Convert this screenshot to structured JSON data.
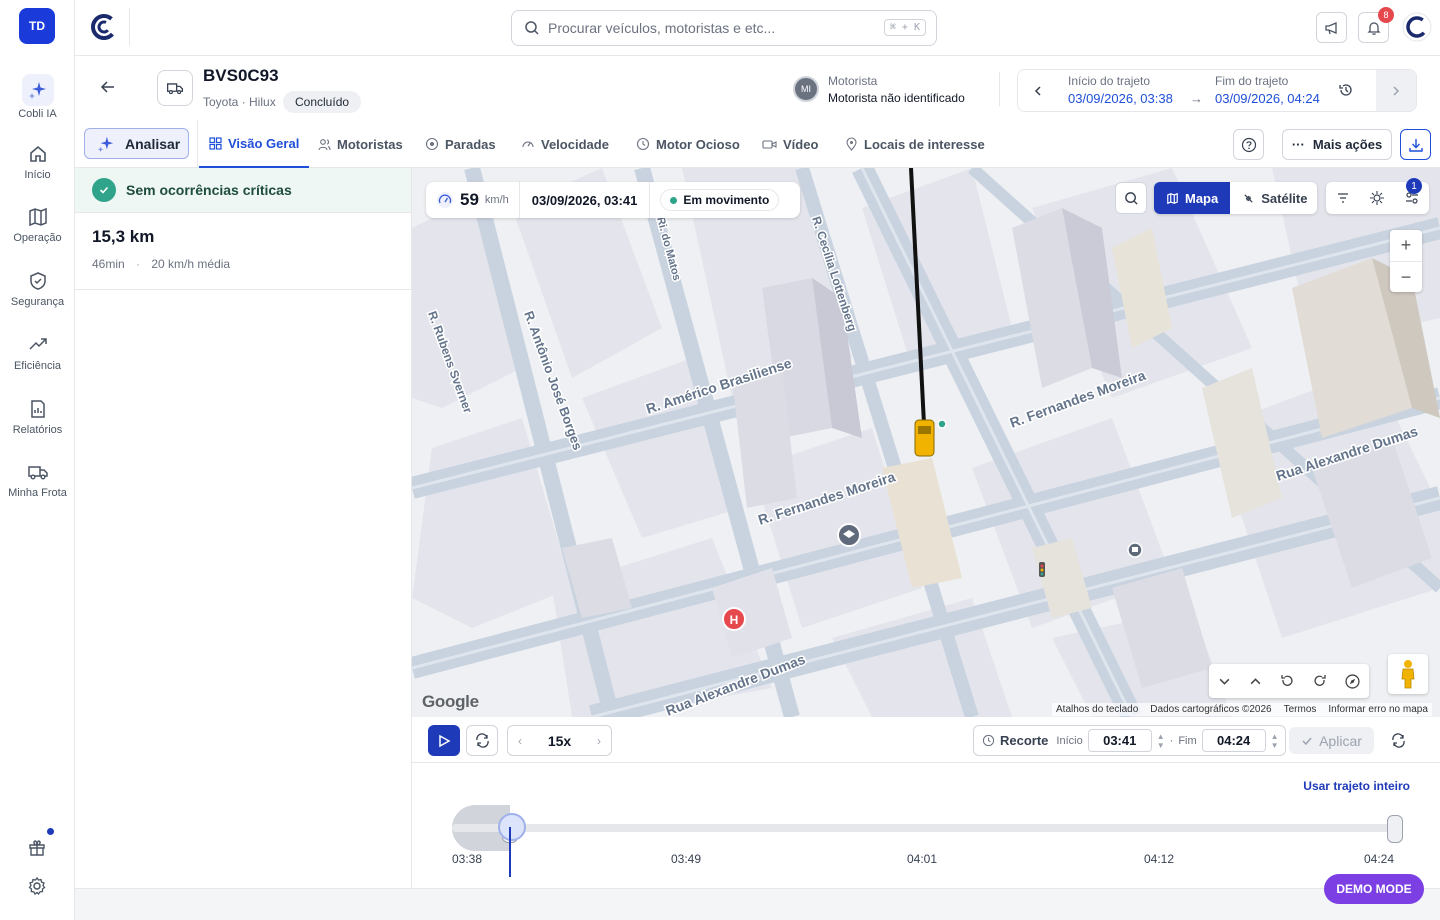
{
  "user": {
    "initials": "TD"
  },
  "rail": {
    "items": [
      {
        "label": "Cobli IA"
      },
      {
        "label": "Início"
      },
      {
        "label": "Operação"
      },
      {
        "label": "Segurança"
      },
      {
        "label": "Eficiência"
      },
      {
        "label": "Relatórios"
      },
      {
        "label": "Minha Frota"
      }
    ]
  },
  "header": {
    "search_placeholder": "Procurar veículos, motoristas e etc...",
    "shortcut": "⌘ + K",
    "notifications_count": "8"
  },
  "trip": {
    "plate": "BVS0C93",
    "model": "Toyota · Hilux",
    "status": "Concluído",
    "driver_initials": "MI",
    "driver_label": "Motorista",
    "driver_name": "Motorista não identificado",
    "start_label": "Início do trajeto",
    "start_value": "03/09/2026, 03:38",
    "end_label": "Fim do trajeto",
    "end_value": "03/09/2026, 04:24"
  },
  "tabs": {
    "analyze": "Analisar",
    "items": [
      {
        "label": "Visão Geral"
      },
      {
        "label": "Motoristas"
      },
      {
        "label": "Paradas"
      },
      {
        "label": "Velocidade"
      },
      {
        "label": "Motor Ocioso"
      },
      {
        "label": "Vídeo"
      },
      {
        "label": "Locais de interesse"
      }
    ],
    "more_actions": "Mais ações"
  },
  "summary": {
    "alert": "Sem ocorrências críticas",
    "distance": "15,3 km",
    "duration": "46min",
    "avg_speed": "20 km/h média"
  },
  "map": {
    "speed": "59",
    "speed_unit": "km/h",
    "datetime": "03/09/2026, 03:41",
    "state": "Em movimento",
    "type_map": "Mapa",
    "type_satellite": "Satélite",
    "filter_count": "1",
    "google": "Google",
    "attribution": [
      "Atalhos do teclado",
      "Dados cartográficos ©2026",
      "Termos",
      "Informar erro no mapa"
    ],
    "streets": [
      {
        "name": "R. Américo Brasiliense"
      },
      {
        "name": "R. Fernandes Moreira"
      },
      {
        "name": "R. Fernandes Moreira"
      },
      {
        "name": "Rua Alexandre Dumas"
      },
      {
        "name": "Rua Alexandre Dumas"
      },
      {
        "name": "R. Antônio José Borges"
      },
      {
        "name": "R. Rubens Sverner"
      },
      {
        "name": "R. Cecília Lottenberg"
      },
      {
        "name": "Ri. do Matos"
      }
    ]
  },
  "playback": {
    "speed": "15x",
    "recorte_label": "Recorte",
    "start_label": "Início",
    "start_time": "03:41",
    "end_label": "Fim",
    "end_time": "04:24",
    "apply_label": "Aplicar"
  },
  "timeline": {
    "use_whole": "Usar trajeto inteiro",
    "ticks": [
      "03:38",
      "03:49",
      "04:01",
      "04:12",
      "04:24"
    ],
    "position_fraction": 0.065
  },
  "demo_label": "DEMO MODE"
}
